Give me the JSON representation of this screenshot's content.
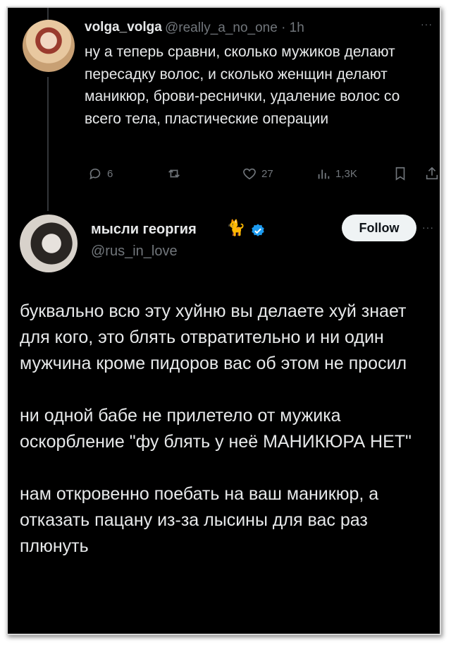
{
  "tweet1": {
    "author_name": "volga_volga",
    "handle_time": "@really_a_no_one · 1h",
    "text": "ну а теперь сравни, сколько мужиков делают пересадку волос, и сколько женщин делают маникюр, брови-реснички, удаление волос со всего тела, пластические операции",
    "stats": {
      "replies": "6",
      "retweets": "",
      "likes": "27",
      "views": "1,3K"
    }
  },
  "tweet2": {
    "author_name": "мысли георгия",
    "name_emoji": "🐈",
    "handle": "@rus_in_love",
    "follow_label": "Follow",
    "paragraphs": [
      "буквально всю эту хуйню вы делаете хуй знает для кого, это блять отвратительно и ни один мужчина кроме пидоров вас об этом не просил",
      "ни одной бабе не прилетело от мужика оскорбление \"фу блять у неё МАНИКЮРА НЕТ\"",
      "нам откровенно поебать на ваш маникюр, а отказать пацану из-за лысины для вас раз плюнуть"
    ]
  },
  "more_label": "···",
  "colors": {
    "background": "#000000",
    "text": "#e7e9ea",
    "muted": "#71767b",
    "verified": "#1d9bf0",
    "follow_bg": "#eff3f4"
  },
  "icons": [
    "reply-icon",
    "retweet-icon",
    "like-icon",
    "views-icon",
    "bookmark-icon",
    "share-icon",
    "verified-badge-icon",
    "more-icon"
  ]
}
